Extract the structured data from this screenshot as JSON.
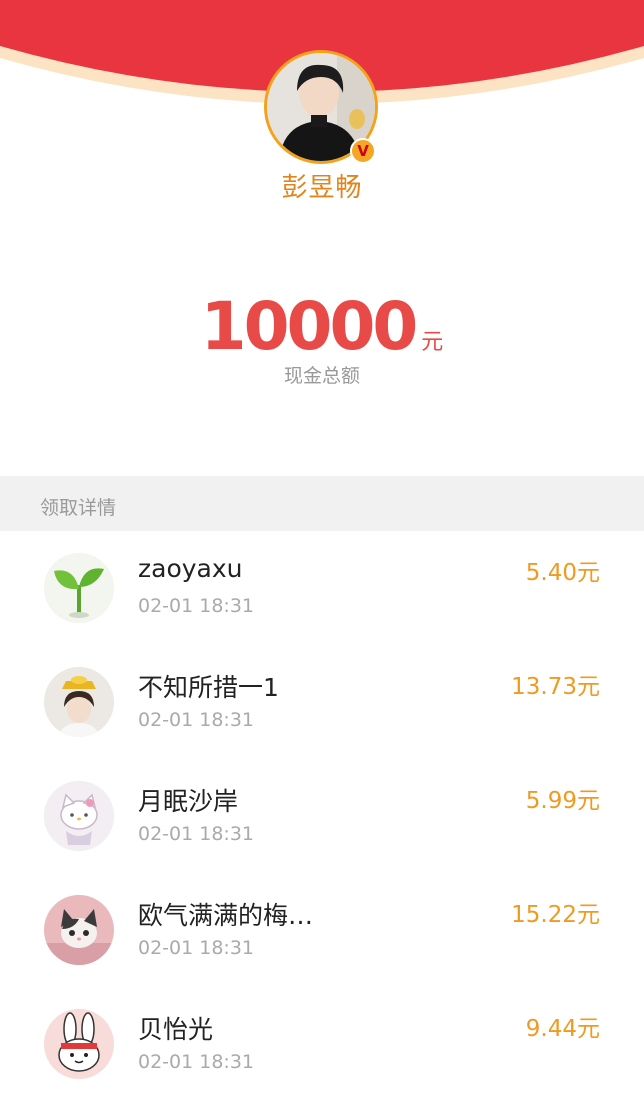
{
  "header": {
    "sender_name": "彭昱畅",
    "badge": "V",
    "colors": {
      "banner": "#e8353f",
      "rim": "#fbe3c4",
      "gold": "#f3a21b"
    }
  },
  "summary": {
    "amount": "10000",
    "unit": "元",
    "label": "现金总额"
  },
  "details": {
    "title": "领取详情",
    "items": [
      {
        "name": "zaoyaxu",
        "time": "02-01 18:31",
        "amount": "5.40元",
        "avatar": "sprout-avatar"
      },
      {
        "name": "不知所措一1",
        "time": "02-01 18:31",
        "amount": "13.73元",
        "avatar": "girl-gold-ingot-avatar"
      },
      {
        "name": "月眠沙岸",
        "time": "02-01 18:31",
        "amount": "5.99元",
        "avatar": "hello-kitty-avatar"
      },
      {
        "name": "欧气满满的梅…",
        "time": "02-01 18:31",
        "amount": "15.22元",
        "avatar": "kitten-avatar"
      },
      {
        "name": "贝怡光",
        "time": "02-01 18:31",
        "amount": "9.44元",
        "avatar": "bunny-avatar"
      }
    ]
  }
}
